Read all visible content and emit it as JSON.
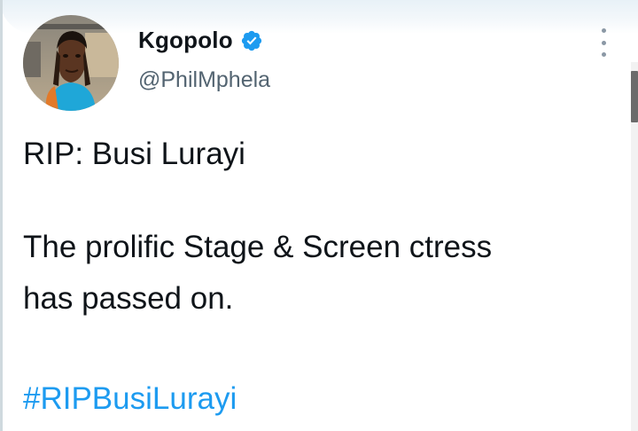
{
  "tweet": {
    "author": {
      "display_name": "Kgopolo",
      "handle": "@PhilMphela",
      "verified": true
    },
    "text_lines": [
      "RIP: Busi Lurayi",
      "The prolific Stage & Screen ctress",
      "has passed on."
    ],
    "hashtag": "#RIPBusiLurayi"
  },
  "icons": {
    "verified": "verified-badge-icon",
    "more": "more-options-icon"
  },
  "colors": {
    "text": "#0f1419",
    "secondary": "#536471",
    "link": "#1d9bf0",
    "verified": "#1d9bf0"
  }
}
